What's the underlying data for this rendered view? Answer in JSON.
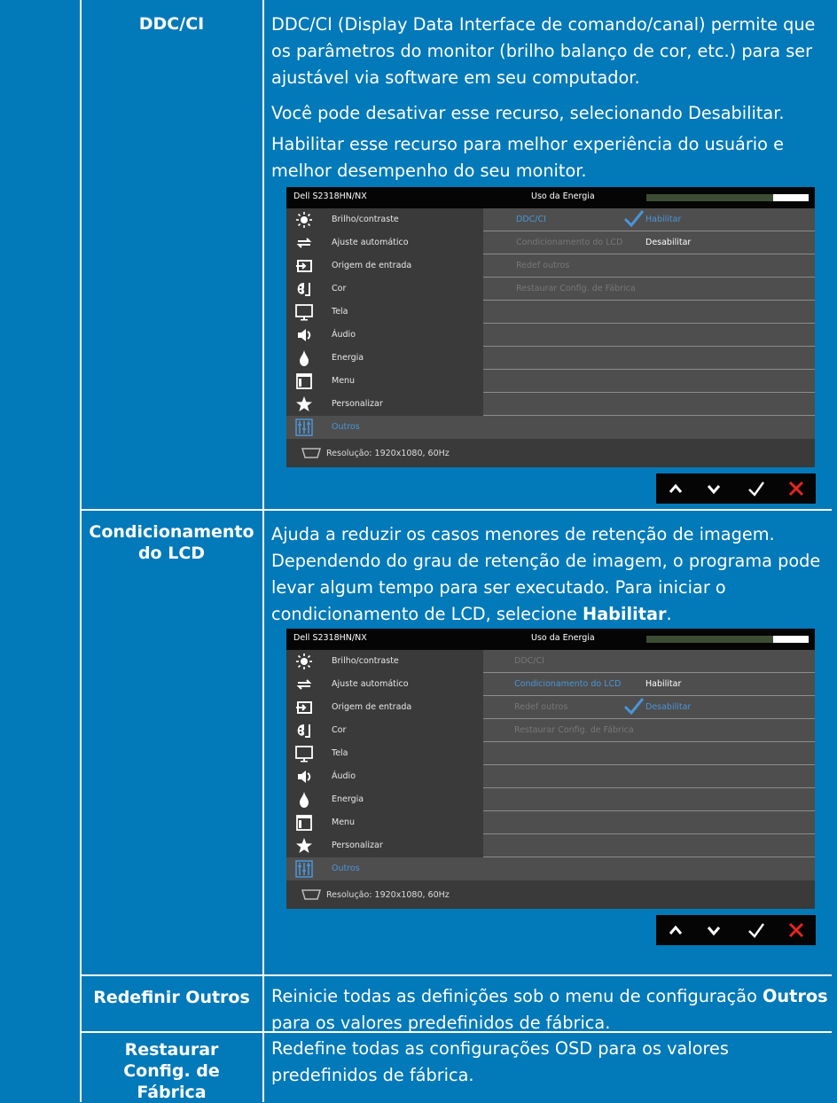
{
  "rows": [
    {
      "label_lines": [
        "DDC/CI"
      ],
      "paragraphs": [
        "DDC/CI (Display Data Interface de comando/canal) permite que os parâmetros do monitor (brilho balanço de cor, etc.) para ser ajustável via software em seu computador.",
        "Você pode desativar esse recurso, selecionando Desabilitar.",
        "Habilitar esse recurso para melhor experiência do usuário e melhor desempenho do seu monitor."
      ]
    },
    {
      "label_lines": [
        "Condicionamento",
        "do LCD"
      ],
      "paragraph_pre": "Ajuda a reduzir os casos menores de retenção de imagem. Dependendo do grau de retenção de imagem, o programa pode levar algum tempo para ser executado. Para iniciar o condicionamento de LCD, selecione ",
      "paragraph_bold": "Habilitar",
      "paragraph_post": "."
    },
    {
      "label_lines": [
        "Redefinir Outros"
      ],
      "paragraph_pre": "Reinicie todas as definições sob o menu de configuração ",
      "paragraph_bold": "Outros",
      "paragraph_post": " para os valores predefinidos de fábrica."
    },
    {
      "label_lines": [
        "Restaurar",
        "Config. de",
        "Fábrica"
      ],
      "paragraph": "Redefine todas as configurações OSD para os valores predefinidos de fábrica."
    }
  ],
  "osd": {
    "model": "Dell S2318HN/NX",
    "energy_label": "Uso da Energia",
    "energy_level": 0.78,
    "resolution": "Resolução: 1920x1080, 60Hz",
    "menu_items": [
      {
        "label": "Brilho/contraste",
        "icon": "brightness-icon"
      },
      {
        "label": "Ajuste automático",
        "icon": "auto-adjust-icon"
      },
      {
        "label": "Origem de entrada",
        "icon": "input-source-icon"
      },
      {
        "label": "Cor",
        "icon": "color-icon"
      },
      {
        "label": "Tela",
        "icon": "display-icon"
      },
      {
        "label": "Áudio",
        "icon": "audio-icon"
      },
      {
        "label": "Energia",
        "icon": "energy-icon"
      },
      {
        "label": "Menu",
        "icon": "menu-icon"
      },
      {
        "label": "Personalizar",
        "icon": "star-icon"
      },
      {
        "label": "Outros",
        "icon": "others-icon"
      }
    ],
    "sub_items": [
      "DDC/CI",
      "Condicionamento do LCD",
      "Redef outros",
      "Restaurar Config. de Fábrica"
    ],
    "screen1": {
      "opt_enable": "Habilitar",
      "opt_disable": "Desabilitar"
    },
    "screen2": {
      "opt_enable": "Habilitar",
      "opt_disable": "Desabilitar"
    }
  },
  "buttons": [
    "up-icon",
    "down-icon",
    "check-icon",
    "close-icon"
  ]
}
